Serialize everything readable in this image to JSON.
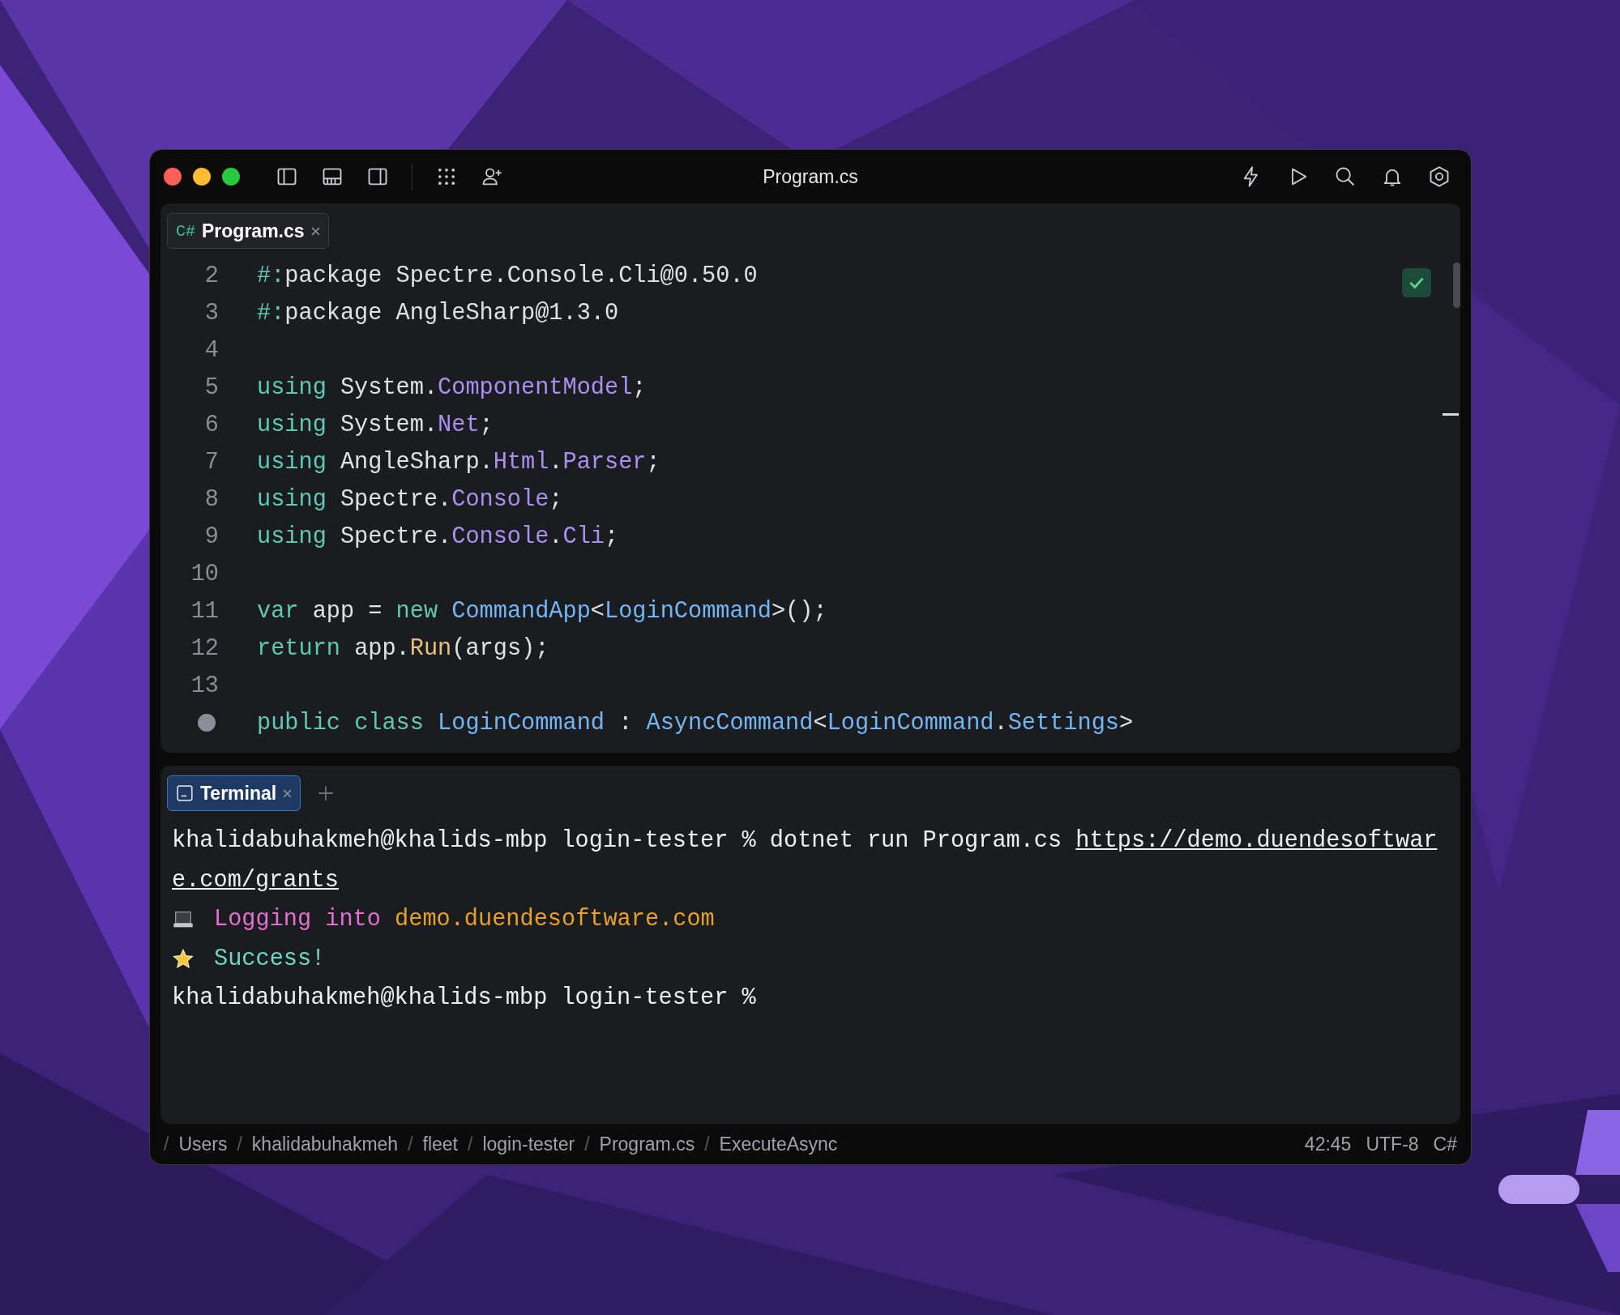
{
  "window": {
    "title": "Program.cs"
  },
  "editor": {
    "tab": {
      "badge": "C#",
      "label": "Program.cs",
      "active": false
    },
    "lines": [
      {
        "kind": "numbered",
        "number": "2",
        "tokens": [
          {
            "text": "#:",
            "kind": "directive"
          },
          {
            "text": "package Spectre.Console.Cli@0.50.0",
            "kind": "plain"
          }
        ]
      },
      {
        "kind": "numbered",
        "number": "3",
        "tokens": [
          {
            "text": "#:",
            "kind": "directive"
          },
          {
            "text": "package AngleSharp@1.3.0",
            "kind": "plain"
          }
        ]
      },
      {
        "kind": "numbered",
        "number": "4"
      },
      {
        "kind": "numbered",
        "number": "5",
        "tokens": [
          {
            "text": "using",
            "kind": "keyword"
          },
          {
            "text": " System.",
            "kind": "plain"
          },
          {
            "text": "ComponentModel",
            "kind": "namespace"
          },
          {
            "text": ";",
            "kind": "plain"
          }
        ]
      },
      {
        "kind": "numbered",
        "number": "6",
        "tokens": [
          {
            "text": "using",
            "kind": "keyword"
          },
          {
            "text": " System.",
            "kind": "plain"
          },
          {
            "text": "Net",
            "kind": "namespace"
          },
          {
            "text": ";",
            "kind": "plain"
          }
        ]
      },
      {
        "kind": "numbered",
        "number": "7",
        "tokens": [
          {
            "text": "using",
            "kind": "keyword"
          },
          {
            "text": " AngleSharp.",
            "kind": "plain"
          },
          {
            "text": "Html",
            "kind": "namespace"
          },
          {
            "text": ".",
            "kind": "plain"
          },
          {
            "text": "Parser",
            "kind": "namespace"
          },
          {
            "text": ";",
            "kind": "plain"
          }
        ]
      },
      {
        "kind": "numbered",
        "number": "8",
        "tokens": [
          {
            "text": "using",
            "kind": "keyword"
          },
          {
            "text": " Spectre.",
            "kind": "plain"
          },
          {
            "text": "Console",
            "kind": "namespace"
          },
          {
            "text": ";",
            "kind": "plain"
          }
        ]
      },
      {
        "kind": "numbered",
        "number": "9",
        "tokens": [
          {
            "text": "using",
            "kind": "keyword"
          },
          {
            "text": " Spectre.",
            "kind": "plain"
          },
          {
            "text": "Console",
            "kind": "namespace"
          },
          {
            "text": ".",
            "kind": "plain"
          },
          {
            "text": "Cli",
            "kind": "namespace"
          },
          {
            "text": ";",
            "kind": "plain"
          }
        ]
      },
      {
        "kind": "numbered",
        "number": "10"
      },
      {
        "kind": "numbered",
        "number": "11",
        "tokens": [
          {
            "text": "var",
            "kind": "keyword"
          },
          {
            "text": " app = ",
            "kind": "plain"
          },
          {
            "text": "new",
            "kind": "keyword"
          },
          {
            "text": " CommandApp",
            "kind": "class"
          },
          {
            "text": "<",
            "kind": "plain"
          },
          {
            "text": "LoginCommand",
            "kind": "class"
          },
          {
            "text": ">();",
            "kind": "plain"
          }
        ]
      },
      {
        "kind": "numbered",
        "number": "12",
        "tokens": [
          {
            "text": "return",
            "kind": "keyword"
          },
          {
            "text": " app.",
            "kind": "plain"
          },
          {
            "text": "Run",
            "kind": "method"
          },
          {
            "text": "(args);",
            "kind": "plain"
          }
        ]
      },
      {
        "kind": "numbered",
        "number": "13"
      },
      {
        "kind": "marked",
        "tokens": [
          {
            "text": "public",
            "kind": "keyword"
          },
          {
            "text": " class",
            "kind": "keyword"
          },
          {
            "text": " LoginCommand",
            "kind": "class"
          },
          {
            "text": " : ",
            "kind": "plain"
          },
          {
            "text": "AsyncCommand",
            "kind": "class"
          },
          {
            "text": "<",
            "kind": "plain"
          },
          {
            "text": "LoginCommand",
            "kind": "class"
          },
          {
            "text": ".",
            "kind": "plain"
          },
          {
            "text": "Settings",
            "kind": "class"
          },
          {
            "text": ">",
            "kind": "plain"
          }
        ]
      }
    ]
  },
  "terminal": {
    "tab": {
      "label": "Terminal",
      "active": true
    },
    "lines": [
      {
        "kind": "command",
        "segments": [
          {
            "text": "khalidabuhakmeh@khalids-mbp login-tester % dotnet run Program.cs ",
            "kind": "plain"
          },
          {
            "text": "https://demo.duendesoftware.com/grants",
            "kind": "link"
          }
        ]
      },
      {
        "kind": "status",
        "segments": [
          {
            "text": "Logging into ",
            "kind": "magenta"
          },
          {
            "text": "demo.duendesoftware.com",
            "kind": "orange"
          }
        ]
      },
      {
        "kind": "success",
        "segments": [
          {
            "text": "Success!",
            "kind": "teal"
          }
        ]
      },
      {
        "kind": "prompt",
        "segments": [
          {
            "text": "khalidabuhakmeh@khalids-mbp login-tester %",
            "kind": "plain"
          }
        ]
      }
    ]
  },
  "status_bar": {
    "breadcrumbs": [
      {
        "separator": "/",
        "label": "Users"
      },
      {
        "separator": "/",
        "label": "khalidabuhakmeh"
      },
      {
        "separator": "/",
        "label": "fleet"
      },
      {
        "separator": "/",
        "label": "login-tester"
      },
      {
        "separator": "/",
        "label": "Program.cs"
      },
      {
        "separator": "/",
        "label": "ExecuteAsync"
      }
    ],
    "position": "42:45",
    "encoding": "UTF-8",
    "language": "C#"
  }
}
